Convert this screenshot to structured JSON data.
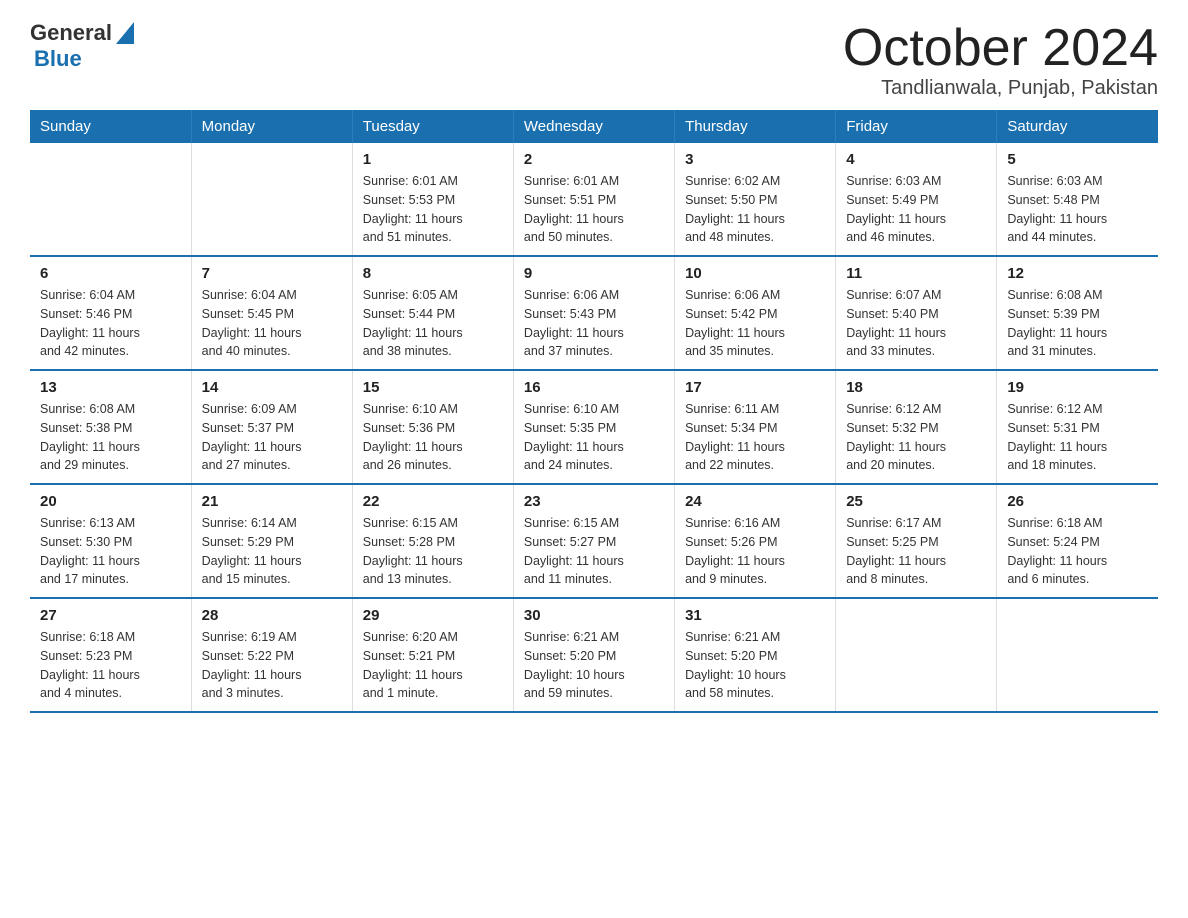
{
  "header": {
    "logo": {
      "general": "General",
      "blue": "Blue"
    },
    "title": "October 2024",
    "location": "Tandlianwala, Punjab, Pakistan"
  },
  "days_of_week": [
    "Sunday",
    "Monday",
    "Tuesday",
    "Wednesday",
    "Thursday",
    "Friday",
    "Saturday"
  ],
  "weeks": [
    [
      {
        "day": "",
        "info": ""
      },
      {
        "day": "",
        "info": ""
      },
      {
        "day": "1",
        "info": "Sunrise: 6:01 AM\nSunset: 5:53 PM\nDaylight: 11 hours\nand 51 minutes."
      },
      {
        "day": "2",
        "info": "Sunrise: 6:01 AM\nSunset: 5:51 PM\nDaylight: 11 hours\nand 50 minutes."
      },
      {
        "day": "3",
        "info": "Sunrise: 6:02 AM\nSunset: 5:50 PM\nDaylight: 11 hours\nand 48 minutes."
      },
      {
        "day": "4",
        "info": "Sunrise: 6:03 AM\nSunset: 5:49 PM\nDaylight: 11 hours\nand 46 minutes."
      },
      {
        "day": "5",
        "info": "Sunrise: 6:03 AM\nSunset: 5:48 PM\nDaylight: 11 hours\nand 44 minutes."
      }
    ],
    [
      {
        "day": "6",
        "info": "Sunrise: 6:04 AM\nSunset: 5:46 PM\nDaylight: 11 hours\nand 42 minutes."
      },
      {
        "day": "7",
        "info": "Sunrise: 6:04 AM\nSunset: 5:45 PM\nDaylight: 11 hours\nand 40 minutes."
      },
      {
        "day": "8",
        "info": "Sunrise: 6:05 AM\nSunset: 5:44 PM\nDaylight: 11 hours\nand 38 minutes."
      },
      {
        "day": "9",
        "info": "Sunrise: 6:06 AM\nSunset: 5:43 PM\nDaylight: 11 hours\nand 37 minutes."
      },
      {
        "day": "10",
        "info": "Sunrise: 6:06 AM\nSunset: 5:42 PM\nDaylight: 11 hours\nand 35 minutes."
      },
      {
        "day": "11",
        "info": "Sunrise: 6:07 AM\nSunset: 5:40 PM\nDaylight: 11 hours\nand 33 minutes."
      },
      {
        "day": "12",
        "info": "Sunrise: 6:08 AM\nSunset: 5:39 PM\nDaylight: 11 hours\nand 31 minutes."
      }
    ],
    [
      {
        "day": "13",
        "info": "Sunrise: 6:08 AM\nSunset: 5:38 PM\nDaylight: 11 hours\nand 29 minutes."
      },
      {
        "day": "14",
        "info": "Sunrise: 6:09 AM\nSunset: 5:37 PM\nDaylight: 11 hours\nand 27 minutes."
      },
      {
        "day": "15",
        "info": "Sunrise: 6:10 AM\nSunset: 5:36 PM\nDaylight: 11 hours\nand 26 minutes."
      },
      {
        "day": "16",
        "info": "Sunrise: 6:10 AM\nSunset: 5:35 PM\nDaylight: 11 hours\nand 24 minutes."
      },
      {
        "day": "17",
        "info": "Sunrise: 6:11 AM\nSunset: 5:34 PM\nDaylight: 11 hours\nand 22 minutes."
      },
      {
        "day": "18",
        "info": "Sunrise: 6:12 AM\nSunset: 5:32 PM\nDaylight: 11 hours\nand 20 minutes."
      },
      {
        "day": "19",
        "info": "Sunrise: 6:12 AM\nSunset: 5:31 PM\nDaylight: 11 hours\nand 18 minutes."
      }
    ],
    [
      {
        "day": "20",
        "info": "Sunrise: 6:13 AM\nSunset: 5:30 PM\nDaylight: 11 hours\nand 17 minutes."
      },
      {
        "day": "21",
        "info": "Sunrise: 6:14 AM\nSunset: 5:29 PM\nDaylight: 11 hours\nand 15 minutes."
      },
      {
        "day": "22",
        "info": "Sunrise: 6:15 AM\nSunset: 5:28 PM\nDaylight: 11 hours\nand 13 minutes."
      },
      {
        "day": "23",
        "info": "Sunrise: 6:15 AM\nSunset: 5:27 PM\nDaylight: 11 hours\nand 11 minutes."
      },
      {
        "day": "24",
        "info": "Sunrise: 6:16 AM\nSunset: 5:26 PM\nDaylight: 11 hours\nand 9 minutes."
      },
      {
        "day": "25",
        "info": "Sunrise: 6:17 AM\nSunset: 5:25 PM\nDaylight: 11 hours\nand 8 minutes."
      },
      {
        "day": "26",
        "info": "Sunrise: 6:18 AM\nSunset: 5:24 PM\nDaylight: 11 hours\nand 6 minutes."
      }
    ],
    [
      {
        "day": "27",
        "info": "Sunrise: 6:18 AM\nSunset: 5:23 PM\nDaylight: 11 hours\nand 4 minutes."
      },
      {
        "day": "28",
        "info": "Sunrise: 6:19 AM\nSunset: 5:22 PM\nDaylight: 11 hours\nand 3 minutes."
      },
      {
        "day": "29",
        "info": "Sunrise: 6:20 AM\nSunset: 5:21 PM\nDaylight: 11 hours\nand 1 minute."
      },
      {
        "day": "30",
        "info": "Sunrise: 6:21 AM\nSunset: 5:20 PM\nDaylight: 10 hours\nand 59 minutes."
      },
      {
        "day": "31",
        "info": "Sunrise: 6:21 AM\nSunset: 5:20 PM\nDaylight: 10 hours\nand 58 minutes."
      },
      {
        "day": "",
        "info": ""
      },
      {
        "day": "",
        "info": ""
      }
    ]
  ]
}
